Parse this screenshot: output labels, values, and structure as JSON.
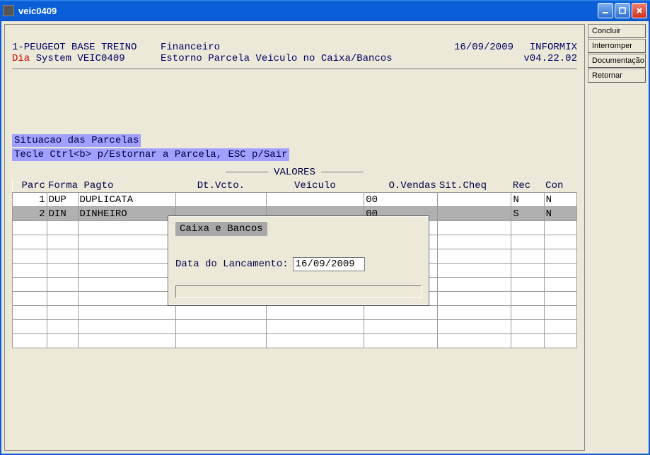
{
  "window": {
    "title": "veic0409"
  },
  "sidebar": {
    "buttons": [
      "Concluir",
      "Interromper",
      "Documentação",
      "Retornar"
    ]
  },
  "header": {
    "line1_left": "1-PEUGEOT BASE TREINO",
    "line1_mid": "Financeiro",
    "line1_date": "16/09/2009",
    "line1_right": "INFORMIX",
    "line2_dia": "Dia",
    "line2_system": " System  VEIC0409",
    "line2_desc": "Estorno Parcela Veiculo no Caixa/Bancos",
    "line2_ver": "v04.22.02"
  },
  "status": {
    "line1": "Situacao das Parcelas",
    "line2": "Tecle Ctrl<b> p/Estornar a Parcela, ESC p/Sair"
  },
  "valores_label": "VALORES",
  "columns": {
    "parc": "Parc",
    "forma": "Forma Pagto",
    "dtvcto": "Dt.Vcto.",
    "veiculo": "Veiculo",
    "ovendas": "O.Vendas",
    "sitcheq": "Sit.Cheq",
    "rec": "Rec",
    "con": "Con"
  },
  "rows": [
    {
      "parc": "1",
      "forma_c": "DUP",
      "forma_d": "DUPLICATA",
      "dtvcto": "",
      "veiculo": "",
      "ovendas": "00",
      "sitcheq": "",
      "rec": "N",
      "con": "N"
    },
    {
      "parc": "2",
      "forma_c": "DIN",
      "forma_d": "DINHEIRO",
      "dtvcto": "",
      "veiculo": "",
      "ovendas": "00",
      "sitcheq": "",
      "rec": "S",
      "con": "N"
    }
  ],
  "popup": {
    "title": "Caixa e Bancos",
    "field_label": "Data do Lancamento:",
    "field_value": "16/09/2009"
  }
}
